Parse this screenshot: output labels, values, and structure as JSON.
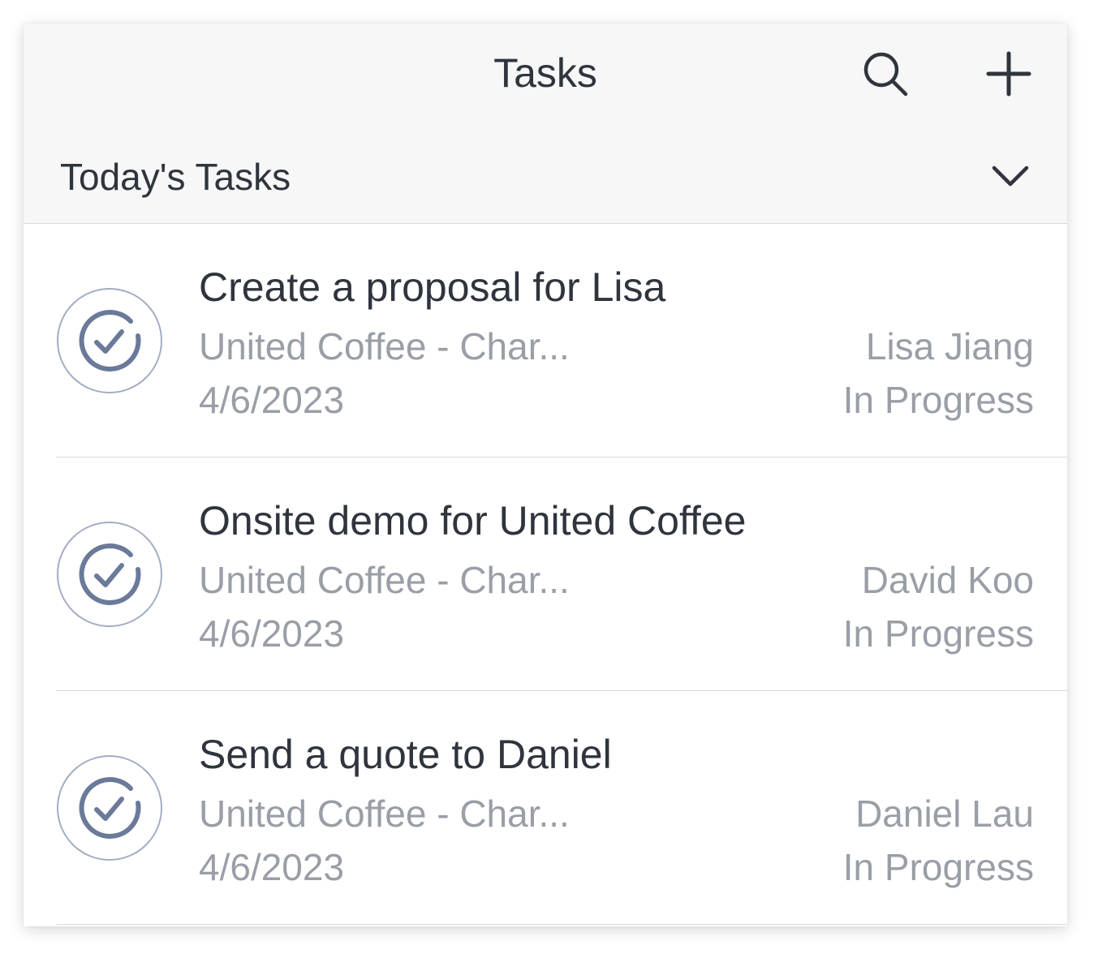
{
  "header": {
    "title": "Tasks",
    "search_icon": "search-icon",
    "add_icon": "plus-icon"
  },
  "filter": {
    "label": "Today's Tasks",
    "icon": "chevron-down-icon"
  },
  "tasks": [
    {
      "title": "Create a proposal for Lisa",
      "account": "United Coffee - Char...",
      "date": "4/6/2023",
      "owner": "Lisa Jiang",
      "status": "In Progress"
    },
    {
      "title": "Onsite demo for United Coffee",
      "account": "United Coffee - Char...",
      "date": "4/6/2023",
      "owner": "David Koo",
      "status": "In Progress"
    },
    {
      "title": "Send a quote to Daniel",
      "account": "United Coffee - Char...",
      "date": "4/6/2023",
      "owner": "Daniel Lau",
      "status": "In Progress"
    }
  ],
  "colors": {
    "header_bg": "#f7f7f7",
    "primary_text": "#2f343d",
    "secondary_text": "#9a9ea6",
    "check_icon": "#6b7a99",
    "check_ring": "#a3adc2",
    "divider": "#d9d9d9"
  }
}
